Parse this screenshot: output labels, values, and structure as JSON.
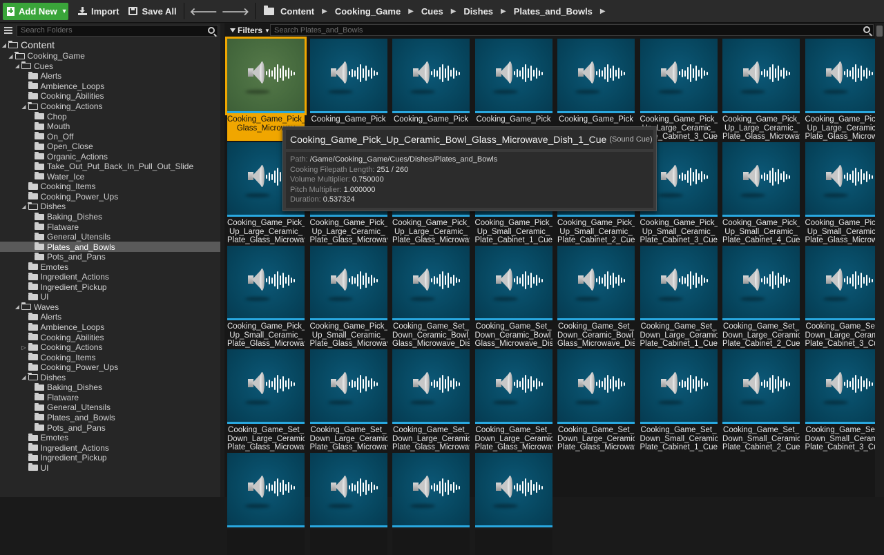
{
  "toolbar": {
    "add_new": "Add New",
    "import": "Import",
    "save_all": "Save All"
  },
  "breadcrumb": [
    "Content",
    "Cooking_Game",
    "Cues",
    "Dishes",
    "Plates_and_Bowls"
  ],
  "folder_search": {
    "placeholder": "Search Folders"
  },
  "asset_search": {
    "placeholder": "Search Plates_and_Bowls"
  },
  "filters_label": "Filters",
  "tree": [
    {
      "label": "Content",
      "depth": 0,
      "open": true,
      "root": true
    },
    {
      "label": "Cooking_Game",
      "depth": 1,
      "open": true
    },
    {
      "label": "Cues",
      "depth": 2,
      "open": true
    },
    {
      "label": "Alerts",
      "depth": 3
    },
    {
      "label": "Ambience_Loops",
      "depth": 3
    },
    {
      "label": "Cooking_Abilities",
      "depth": 3
    },
    {
      "label": "Cooking_Actions",
      "depth": 3,
      "open": true
    },
    {
      "label": "Chop",
      "depth": 4
    },
    {
      "label": "Mouth",
      "depth": 4
    },
    {
      "label": "On_Off",
      "depth": 4
    },
    {
      "label": "Open_Close",
      "depth": 4
    },
    {
      "label": "Organic_Actions",
      "depth": 4
    },
    {
      "label": "Take_Out_Put_Back_In_Pull_Out_Slide",
      "depth": 4
    },
    {
      "label": "Water_Ice",
      "depth": 4
    },
    {
      "label": "Cooking_Items",
      "depth": 3
    },
    {
      "label": "Cooking_Power_Ups",
      "depth": 3
    },
    {
      "label": "Dishes",
      "depth": 3,
      "open": true
    },
    {
      "label": "Baking_Dishes",
      "depth": 4
    },
    {
      "label": "Flatware",
      "depth": 4
    },
    {
      "label": "General_Utensils",
      "depth": 4
    },
    {
      "label": "Plates_and_Bowls",
      "depth": 4,
      "selected": true
    },
    {
      "label": "Pots_and_Pans",
      "depth": 4
    },
    {
      "label": "Emotes",
      "depth": 3
    },
    {
      "label": "Ingredient_Actions",
      "depth": 3
    },
    {
      "label": "Ingredient_Pickup",
      "depth": 3
    },
    {
      "label": "UI",
      "depth": 3
    },
    {
      "label": "Waves",
      "depth": 2,
      "open": true
    },
    {
      "label": "Alerts",
      "depth": 3
    },
    {
      "label": "Ambience_Loops",
      "depth": 3
    },
    {
      "label": "Cooking_Abilities",
      "depth": 3
    },
    {
      "label": "Cooking_Actions",
      "depth": 3,
      "collapsed": true
    },
    {
      "label": "Cooking_Items",
      "depth": 3
    },
    {
      "label": "Cooking_Power_Ups",
      "depth": 3
    },
    {
      "label": "Dishes",
      "depth": 3,
      "open": true
    },
    {
      "label": "Baking_Dishes",
      "depth": 4
    },
    {
      "label": "Flatware",
      "depth": 4
    },
    {
      "label": "General_Utensils",
      "depth": 4
    },
    {
      "label": "Plates_and_Bowls",
      "depth": 4
    },
    {
      "label": "Pots_and_Pans",
      "depth": 4
    },
    {
      "label": "Emotes",
      "depth": 3
    },
    {
      "label": "Ingredient_Actions",
      "depth": 3
    },
    {
      "label": "Ingredient_Pickup",
      "depth": 3
    },
    {
      "label": "UI",
      "depth": 3
    }
  ],
  "assets": [
    {
      "label": "Cooking_Game_Pick_Up_Ceramic_B Glass_Microwav",
      "selected": true
    },
    {
      "label": "Cooking_Game_Pick"
    },
    {
      "label": "Cooking_Game_Pick"
    },
    {
      "label": "Cooking_Game_Pick"
    },
    {
      "label": "Cooking_Game_Pick"
    },
    {
      "label": "Cooking_Game_Pick_ Up_Large_Ceramic_ Plate_Cabinet_3_Cue"
    },
    {
      "label": "Cooking_Game_Pick_ Up_Large_Ceramic_ Plate_Glass_Microwave"
    },
    {
      "label": "Cooking_Game_Pick_ Up_Large_Ceramic_ Plate_Glass_Microwave"
    },
    {
      "label": "Cooking_Game_Pick_ Up_Large_Ceramic_ Plate_Glass_Microwave"
    },
    {
      "label": "Cooking_Game_Pick_ Up_Large_Ceramic_ Plate_Glass_Microwave"
    },
    {
      "label": "Cooking_Game_Pick_ Up_Large_Ceramic_ Plate_Glass_Microwave"
    },
    {
      "label": "Cooking_Game_Pick_ Up_Small_Ceramic_ Plate_Cabinet_1_Cue"
    },
    {
      "label": "Cooking_Game_Pick_ Up_Small_Ceramic_ Plate_Cabinet_2_Cue"
    },
    {
      "label": "Cooking_Game_Pick_ Up_Small_Ceramic_ Plate_Cabinet_3_Cue"
    },
    {
      "label": "Cooking_Game_Pick_ Up_Small_Ceramic_ Plate_Cabinet_4_Cue"
    },
    {
      "label": "Cooking_Game_Pick_ Up_Small_Ceramic_ Plate_Glass_Microwave"
    },
    {
      "label": "Cooking_Game_Pick_ Up_Small_Ceramic_ Plate_Glass_Microwave"
    },
    {
      "label": "Cooking_Game_Pick_ Up_Small_Ceramic_ Plate_Glass_Microwave"
    },
    {
      "label": "Cooking_Game_Set_ Down_Ceramic_Bowl_ Glass_Microwave_Dish"
    },
    {
      "label": "Cooking_Game_Set_ Down_Ceramic_Bowl_ Glass_Microwave_Dish"
    },
    {
      "label": "Cooking_Game_Set_ Down_Ceramic_Bowl_ Glass_Microwave_Dish"
    },
    {
      "label": "Cooking_Game_Set_ Down_Large_Ceramic_ Plate_Cabinet_1_Cue"
    },
    {
      "label": "Cooking_Game_Set_ Down_Large_Ceramic_ Plate_Cabinet_2_Cue"
    },
    {
      "label": "Cooking_Game_Set_ Down_Large_Ceramic_ Plate_Cabinet_3_Cue"
    },
    {
      "label": "Cooking_Game_Set_ Down_Large_Ceramic_ Plate_Glass_Microwave"
    },
    {
      "label": "Cooking_Game_Set_ Down_Large_Ceramic_ Plate_Glass_Microwave"
    },
    {
      "label": "Cooking_Game_Set_ Down_Large_Ceramic_ Plate_Glass_Microwave"
    },
    {
      "label": "Cooking_Game_Set_ Down_Large_Ceramic_ Plate_Glass_Microwave"
    },
    {
      "label": "Cooking_Game_Set_ Down_Large_Ceramic_ Plate_Glass_Microwave"
    },
    {
      "label": "Cooking_Game_Set_ Down_Small_Ceramic_ Plate_Cabinet_1_Cue"
    },
    {
      "label": "Cooking_Game_Set_ Down_Small_Ceramic_ Plate_Cabinet_2_Cue"
    },
    {
      "label": "Cooking_Game_Set_ Down_Small_Ceramic_ Plate_Cabinet_3_Cue"
    },
    {
      "label": ""
    },
    {
      "label": ""
    },
    {
      "label": ""
    },
    {
      "label": ""
    }
  ],
  "tooltip": {
    "title": "Cooking_Game_Pick_Up_Ceramic_Bowl_Glass_Microwave_Dish_1_Cue",
    "type": "(Sound Cue)",
    "rows": [
      {
        "key": "Path:",
        "value": "/Game/Cooking_Game/Cues/Dishes/Plates_and_Bowls"
      },
      {
        "key": "Cooking Filepath Length:",
        "value": "251 / 260"
      },
      {
        "key": "Volume Multiplier:",
        "value": "0.750000"
      },
      {
        "key": "Pitch Multiplier:",
        "value": "1.000000"
      },
      {
        "key": "Duration:",
        "value": "0.537324"
      }
    ]
  },
  "icons": {
    "add": "plus-file-icon",
    "import": "import-icon",
    "save": "save-icon",
    "back": "back-arrow-icon",
    "forward": "forward-arrow-icon",
    "folder": "folder-icon",
    "asset": "sound-cue-icon"
  },
  "colors": {
    "accent_green": "#3aa53a",
    "selection_orange": "#f0a600",
    "thumb_blue": "#074861",
    "bar_blue": "#29a8e0"
  }
}
